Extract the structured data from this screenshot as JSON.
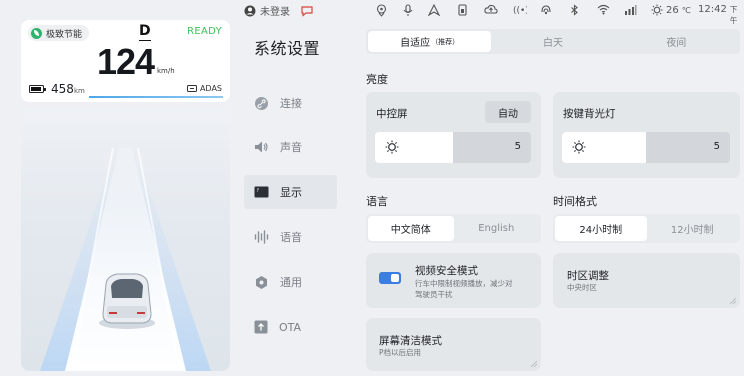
{
  "cluster": {
    "eco_mode": "极致节能",
    "gear": "D",
    "ready": "READY",
    "speed": "124",
    "speed_unit": "km/h",
    "range": "458",
    "range_unit": "km",
    "adas": "ADAS",
    "accent_color": "#3fbf5a"
  },
  "status": {
    "user": "未登录",
    "temperature": "26",
    "temp_unit": "℃",
    "time": "12:42",
    "ampm": "下午",
    "icons": [
      "location-icon",
      "microphone-icon",
      "navigation-icon",
      "sim-icon",
      "cloud-icon",
      "radio-icon",
      "hotspot-icon",
      "bluetooth-icon",
      "wifi-icon",
      "signal-icon",
      "sun-icon"
    ]
  },
  "sidebar": {
    "title": "系统设置",
    "items": [
      {
        "label": "连接",
        "icon": "link-icon"
      },
      {
        "label": "声音",
        "icon": "speaker-icon"
      },
      {
        "label": "显示",
        "icon": "display-icon",
        "active": true
      },
      {
        "label": "语音",
        "icon": "voice-wave-icon"
      },
      {
        "label": "通用",
        "icon": "hexagon-icon"
      },
      {
        "label": "OTA",
        "icon": "upload-icon"
      }
    ]
  },
  "display": {
    "theme_options": [
      {
        "label": "自适应",
        "sub": "（推荐）",
        "selected": true
      },
      {
        "label": "白天"
      },
      {
        "label": "夜间"
      }
    ],
    "brightness_label": "亮度",
    "center_screen": {
      "label": "中控屏",
      "auto_label": "自动",
      "value": "5",
      "level": 0.5
    },
    "key_backlight": {
      "label": "按键背光灯",
      "value": "5",
      "level": 0.5
    },
    "language_label": "语言",
    "language_options": [
      {
        "label": "中文简体",
        "selected": true
      },
      {
        "label": "English"
      }
    ],
    "time_format_label": "时间格式",
    "time_format_options": [
      {
        "label": "24小时制",
        "selected": true
      },
      {
        "label": "12小时制"
      }
    ],
    "video_safety": {
      "title": "视频安全模式",
      "desc_line1": "行车中限制视频播放，减少对",
      "desc_line2": "驾驶员干扰",
      "enabled": true
    },
    "timezone": {
      "title": "时区调整",
      "value": "中央时区"
    },
    "screen_clean": {
      "title": "屏幕清洁模式",
      "desc": "P档以后启用"
    }
  }
}
